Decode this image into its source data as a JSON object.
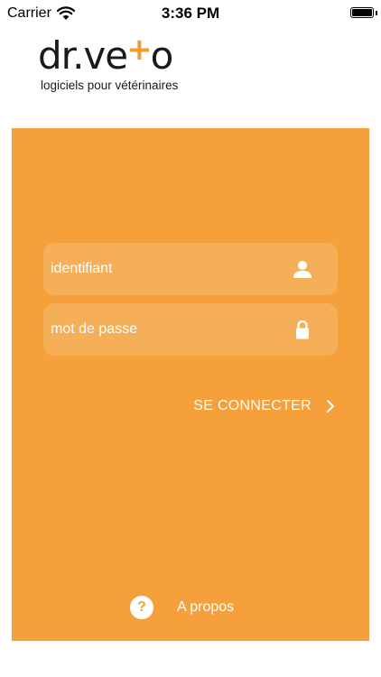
{
  "status_bar": {
    "carrier": "Carrier",
    "time": "3:36 PM",
    "wifi_icon": "wifi-icon",
    "battery_icon": "battery-icon"
  },
  "logo": {
    "text_left": "dr.ve",
    "text_cross": "+",
    "text_right": "o",
    "tagline": "logiciels pour vétérinaires",
    "accent_color": "#f39c2e"
  },
  "login": {
    "panel_color": "#f5a03a",
    "username_placeholder": "identifiant",
    "username_icon": "user-icon",
    "password_placeholder": "mot de passe",
    "password_icon": "lock-icon",
    "connect_label": "SE CONNECTER",
    "connect_icon": "chevron-right-icon"
  },
  "footer": {
    "help_symbol": "?",
    "about_label": "A propos"
  }
}
